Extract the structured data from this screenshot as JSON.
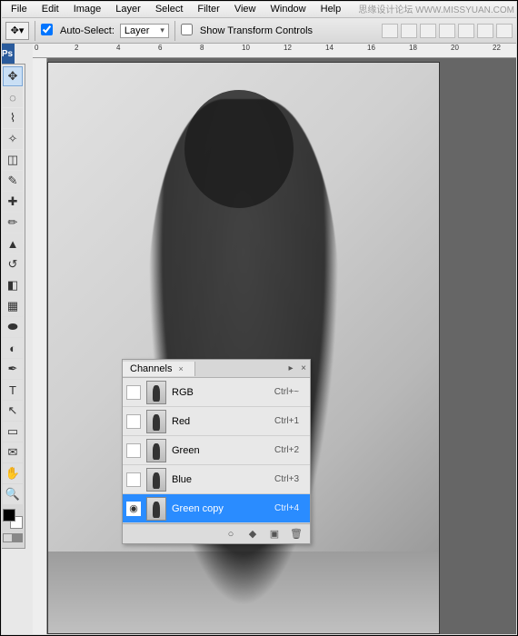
{
  "menu": {
    "file": "File",
    "edit": "Edit",
    "image": "Image",
    "layer": "Layer",
    "select": "Select",
    "filter": "Filter",
    "view": "View",
    "window": "Window",
    "help": "Help"
  },
  "watermark": "思缘设计论坛  WWW.MISSYUAN.COM",
  "options": {
    "auto_select_label": "Auto-Select:",
    "auto_select_value": "Layer",
    "show_transform_label": "Show Transform Controls"
  },
  "ruler": {
    "ticks": [
      "0",
      "2",
      "4",
      "6",
      "8",
      "10",
      "12",
      "14",
      "16",
      "18",
      "20",
      "22"
    ]
  },
  "app_icon": "Ps",
  "tools": [
    {
      "name": "move-tool",
      "glyph": "✥",
      "sel": true
    },
    {
      "name": "marquee-tool",
      "glyph": "◌"
    },
    {
      "name": "lasso-tool",
      "glyph": "⌇"
    },
    {
      "name": "wand-tool",
      "glyph": "✧"
    },
    {
      "name": "crop-tool",
      "glyph": "◫"
    },
    {
      "name": "eyedropper-tool",
      "glyph": "✎"
    },
    {
      "name": "healing-tool",
      "glyph": "✚"
    },
    {
      "name": "brush-tool",
      "glyph": "✏"
    },
    {
      "name": "stamp-tool",
      "glyph": "▲"
    },
    {
      "name": "history-brush-tool",
      "glyph": "↺"
    },
    {
      "name": "eraser-tool",
      "glyph": "◧"
    },
    {
      "name": "gradient-tool",
      "glyph": "▦"
    },
    {
      "name": "blur-tool",
      "glyph": "⬬"
    },
    {
      "name": "dodge-tool",
      "glyph": "◐"
    },
    {
      "name": "pen-tool",
      "glyph": "✒"
    },
    {
      "name": "type-tool",
      "glyph": "T"
    },
    {
      "name": "path-tool",
      "glyph": "↖"
    },
    {
      "name": "shape-tool",
      "glyph": "▭"
    },
    {
      "name": "notes-tool",
      "glyph": "✉"
    },
    {
      "name": "hand-tool",
      "glyph": "✋"
    },
    {
      "name": "zoom-tool",
      "glyph": "🔍"
    }
  ],
  "channels_panel": {
    "title": "Channels",
    "rows": [
      {
        "visible": false,
        "label": "RGB",
        "shortcut": "Ctrl+~",
        "selected": false
      },
      {
        "visible": false,
        "label": "Red",
        "shortcut": "Ctrl+1",
        "selected": false
      },
      {
        "visible": false,
        "label": "Green",
        "shortcut": "Ctrl+2",
        "selected": false
      },
      {
        "visible": false,
        "label": "Blue",
        "shortcut": "Ctrl+3",
        "selected": false
      },
      {
        "visible": true,
        "label": "Green copy",
        "shortcut": "Ctrl+4",
        "selected": true
      }
    ],
    "footer_icons": [
      "load-selection-icon",
      "save-selection-icon",
      "new-channel-icon",
      "delete-channel-icon"
    ]
  },
  "icons": {
    "eye": "◉",
    "load_sel": "○",
    "save_sel": "◆",
    "new": "▣",
    "trash": "🗑",
    "menu": "▸",
    "close": "×",
    "tab_x": "×"
  }
}
